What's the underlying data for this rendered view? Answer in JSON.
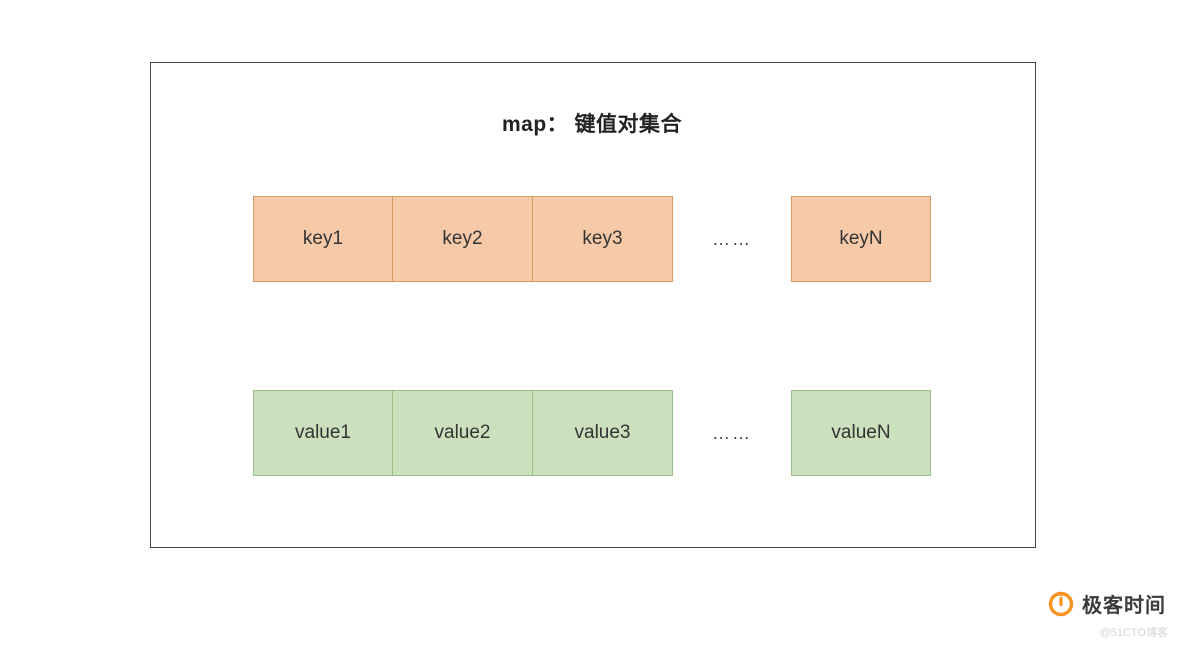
{
  "title": "map： 键值对集合",
  "rows": {
    "keys": {
      "items": [
        "key1",
        "key2",
        "key3"
      ],
      "ellipsis": "……",
      "last": "keyN"
    },
    "values": {
      "items": [
        "value1",
        "value2",
        "value3"
      ],
      "ellipsis": "……",
      "last": "valueN"
    }
  },
  "logo_text": "极客时间",
  "watermark": "@51CTO博客",
  "colors": {
    "key_fill": "#f6c9a9",
    "key_border": "#d99b62",
    "value_fill": "#cbe0bc",
    "value_border": "#98bf86",
    "frame_border": "#454545",
    "logo_accent": "#f7931e"
  }
}
